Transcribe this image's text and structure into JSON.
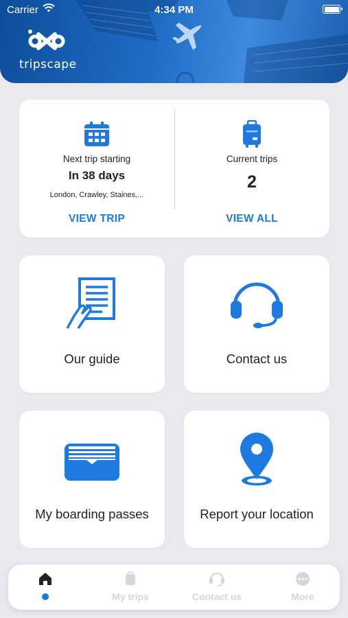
{
  "status_bar": {
    "carrier": "Carrier",
    "time": "4:34 PM"
  },
  "brand": {
    "name": "tripscape"
  },
  "colors": {
    "accent": "#1f7ae0",
    "header": "#1f6cc5",
    "background": "#e9e9ee",
    "inactive_tab": "#d6d6da"
  },
  "trips_summary": {
    "next_trip": {
      "icon": "calendar-icon",
      "label": "Next trip starting",
      "countdown": "In 38 days",
      "places": "London, Crawley, Staines,...",
      "action": "VIEW TRIP"
    },
    "current_trips": {
      "icon": "suitcase-icon",
      "label": "Current trips",
      "count": "2",
      "action": "VIEW ALL"
    }
  },
  "tiles": [
    {
      "label": "Our guide",
      "icon": "guide-document-icon"
    },
    {
      "label": "Contact us",
      "icon": "headset-icon"
    },
    {
      "label": "My boarding passes",
      "icon": "boarding-pass-wallet-icon"
    },
    {
      "label": "Report your location",
      "icon": "location-pin-icon"
    }
  ],
  "tab_bar": {
    "active_index": 0,
    "tabs": [
      {
        "label": "",
        "icon": "home-icon"
      },
      {
        "label": "My trips",
        "icon": "suitcase-icon"
      },
      {
        "label": "Contact us",
        "icon": "headset-icon"
      },
      {
        "label": "More",
        "icon": "more-icon"
      }
    ]
  }
}
